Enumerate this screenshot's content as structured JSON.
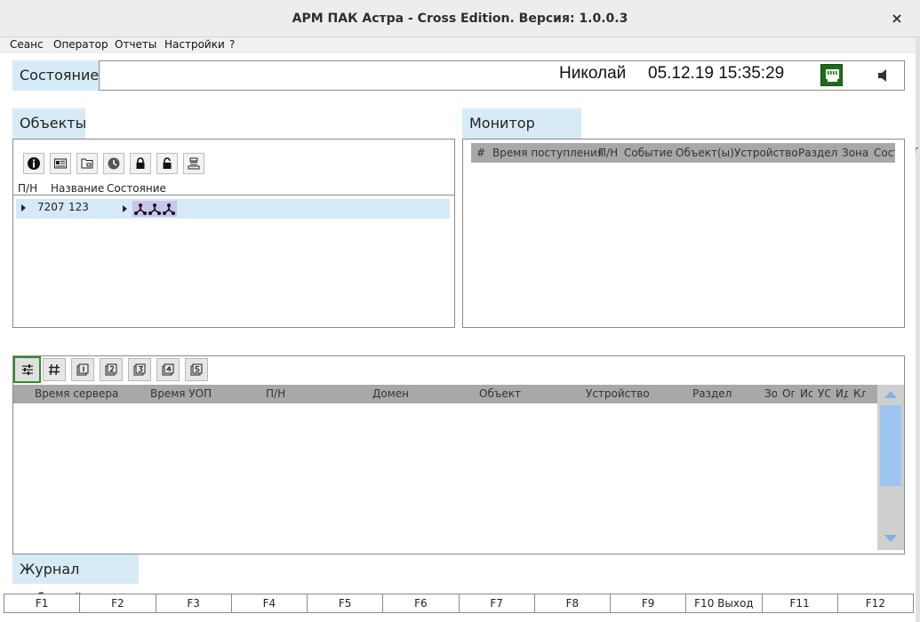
{
  "window": {
    "title": "АРМ ПАК Астра - Cross Edition. Версия: 1.0.0.3",
    "close_glyph": "×"
  },
  "menu": {
    "items": [
      "Сеанс",
      "Оператор",
      "Отчеты",
      "Настройки",
      "?"
    ]
  },
  "status": {
    "label": "Состояние",
    "user": "Николай",
    "datetime": "05.12.19 15:35:29"
  },
  "objects": {
    "label": "Объекты",
    "columns": [
      "П/Н",
      "Название",
      "Состояние"
    ],
    "rows": [
      {
        "pn": "7207",
        "name": "123"
      }
    ]
  },
  "alarm_monitor": {
    "label": "Монитор тревог",
    "columns": [
      "#",
      "Время поступления",
      "П/Н",
      "Событие",
      "Объект(ы)",
      "Устройство",
      "Раздел",
      "Зона",
      "Сост"
    ]
  },
  "journal": {
    "label": "Журнал событий",
    "toolbar_buttons": [
      "settings-sliders-icon",
      "hash-icon",
      "page-1-icon",
      "page-2-icon",
      "page-3-icon",
      "page-4-icon",
      "page-5-icon"
    ],
    "columns": [
      "Время сервера",
      "Время УОП",
      "П/Н",
      "Домен",
      "Объект",
      "Устройство",
      "Раздел",
      "Зо",
      "Оп",
      "Ис",
      "УС",
      "Ид",
      "Кл"
    ]
  },
  "fkeys": [
    "F1",
    "F2",
    "F3",
    "F4",
    "F5",
    "F6",
    "F7",
    "F8",
    "F9",
    "F10 Выход",
    "F11",
    "F12"
  ],
  "side_text": "r",
  "colors": {
    "accent": "#d7ebf6",
    "selection": "#d4eaf8",
    "header": "#a8a8a8",
    "scroll_thumb": "#9ec5ef",
    "network_ok": "#1e6b1a"
  }
}
